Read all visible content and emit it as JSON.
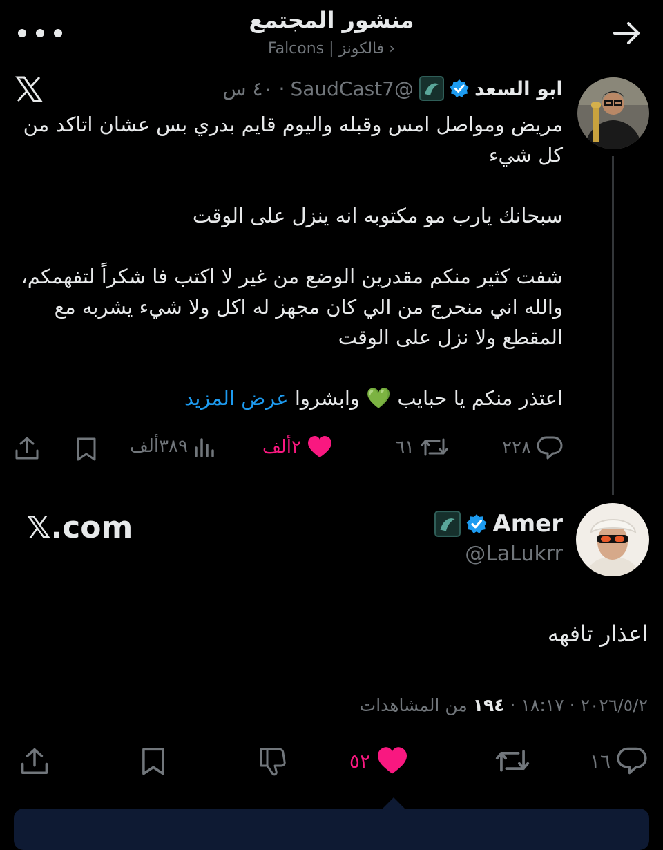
{
  "header": {
    "title": "منشور المجتمع",
    "community": "Falcons | فالكونز ›"
  },
  "tweet1": {
    "name": "ابو السعد",
    "handle": "@SaudCast7",
    "time": "٤٠ س",
    "separator": "·",
    "paragraphs": [
      "مريض ومواصل امس وقبله واليوم قايم بدري بس عشان اتاكد من كل شيء",
      "سبحانك يارب مو مكتوبه انه ينزل على الوقت",
      "شفت كثير منكم مقدرين الوضع من غير لا اكتب فا شكراً لتفهمكم، والله اني منحرج من الي كان مجهز له اكل ولا شيء يشربه مع المقطع ولا نزل على الوقت"
    ],
    "last_line": "اعتذر منكم يا حبايب 💚 وابشروا",
    "show_more": "عرض المزيد",
    "replies": "٢٢٨",
    "retweets": "٦١",
    "likes": "٢ألف",
    "views": "٣٨٩ألف"
  },
  "tweet2": {
    "name": "Amer",
    "handle": "@LaLukrr",
    "watermark": "𝕏.com",
    "text": "اعذار تافهه",
    "date": "٢٠٢٦/٥/٢",
    "time": "١٨:١٧",
    "separator": "·",
    "views_count": "١٩٤",
    "views_label": "من المشاهدات",
    "replies": "١٦",
    "likes": "٥٢"
  },
  "colors": {
    "background": "#000000",
    "text": "#e7e9ea",
    "muted": "#71767b",
    "link": "#1d9bf0",
    "like": "#f91880",
    "verified": "#1d9bf0"
  },
  "icons": [
    "more-icon",
    "back-arrow-icon",
    "x-logo-icon",
    "verified-badge-icon",
    "reply-icon",
    "retweet-icon",
    "heart-icon",
    "views-icon",
    "bookmark-icon",
    "share-icon",
    "dislike-icon"
  ]
}
